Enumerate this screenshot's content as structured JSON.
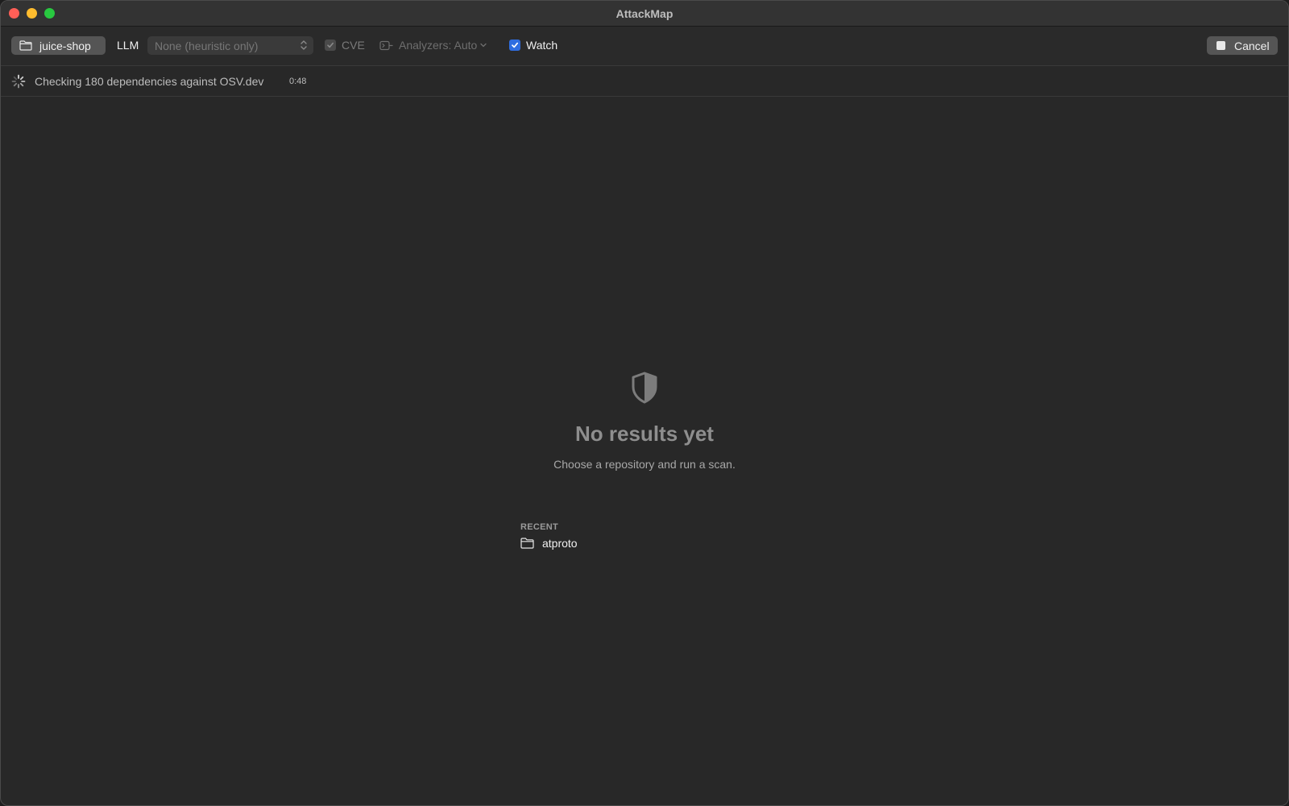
{
  "window": {
    "title": "AttackMap"
  },
  "toolbar": {
    "repo_label": "juice-shop",
    "llm_label": "LLM",
    "llm_value": "None (heuristic only)",
    "cve_label": "CVE",
    "cve_checked": true,
    "cve_enabled": false,
    "analyzers_label": "Analyzers: Auto",
    "watch_label": "Watch",
    "watch_checked": true,
    "cancel_label": "Cancel"
  },
  "status": {
    "text": "Checking 180 dependencies against OSV.dev",
    "elapsed": "0:48"
  },
  "empty_state": {
    "icon": "shield-icon",
    "title": "No results yet",
    "subtitle": "Choose a repository and run a scan."
  },
  "recent": {
    "label": "RECENT",
    "items": [
      {
        "name": "atproto",
        "icon": "folder-icon"
      }
    ]
  },
  "colors": {
    "background": "#282828",
    "accent": "#2f6de0",
    "close": "#ff5f57",
    "minimize": "#febc2e",
    "maximize": "#28c840"
  }
}
